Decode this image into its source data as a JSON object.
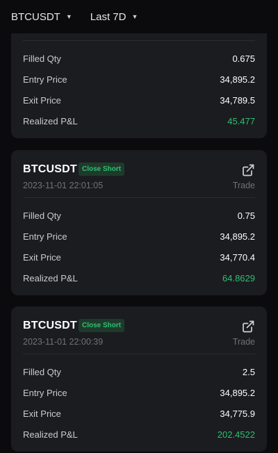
{
  "filters": {
    "symbol": "BTCUSDT",
    "range": "Last 7D"
  },
  "colors": {
    "positive": "#2fbf71",
    "badge_bg": "#1f3a2c",
    "card_bg": "#1b1c20"
  },
  "cards": [
    {
      "rows": [
        {
          "label": "Filled Qty",
          "value": "0.675"
        },
        {
          "label": "Entry Price",
          "value": "34,895.2"
        },
        {
          "label": "Exit Price",
          "value": "34,789.5"
        },
        {
          "label": "Realized P&L",
          "value": "45.477"
        }
      ]
    },
    {
      "symbol": "BTCUSDT",
      "side": "Close Short",
      "time": "2023-11-01 22:01:05",
      "link": "Trade",
      "icon": "external-link-icon",
      "rows": [
        {
          "label": "Filled Qty",
          "value": "0.75"
        },
        {
          "label": "Entry Price",
          "value": "34,895.2"
        },
        {
          "label": "Exit Price",
          "value": "34,770.4"
        },
        {
          "label": "Realized P&L",
          "value": "64.8629"
        }
      ]
    },
    {
      "symbol": "BTCUSDT",
      "side": "Close Short",
      "time": "2023-11-01 22:00:39",
      "link": "Trade",
      "icon": "external-link-icon",
      "rows": [
        {
          "label": "Filled Qty",
          "value": "2.5"
        },
        {
          "label": "Entry Price",
          "value": "34,895.2"
        },
        {
          "label": "Exit Price",
          "value": "34,775.9"
        },
        {
          "label": "Realized P&L",
          "value": "202.4522"
        }
      ]
    }
  ]
}
